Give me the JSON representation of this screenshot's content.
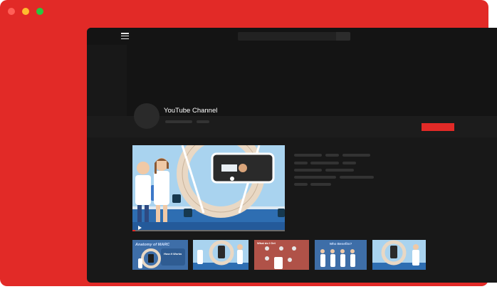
{
  "window": {
    "frame_color": "#e22a27",
    "controls": [
      "close-dot",
      "minimize-dot",
      "maximize-dot"
    ],
    "control_colors": [
      "#ff5f57",
      "#febc2e",
      "#28c840"
    ]
  },
  "channel": {
    "name": "YouTube Channel",
    "accent": "#e22a27"
  },
  "featured_video": {
    "progress": 0.02
  },
  "thumbnails": [
    {
      "title": "Anatomy of MARC",
      "subtitle": "How it Works"
    },
    {
      "title": ""
    },
    {
      "title": "What do I Get"
    },
    {
      "title": "Who Benefits?"
    },
    {
      "title": ""
    }
  ]
}
